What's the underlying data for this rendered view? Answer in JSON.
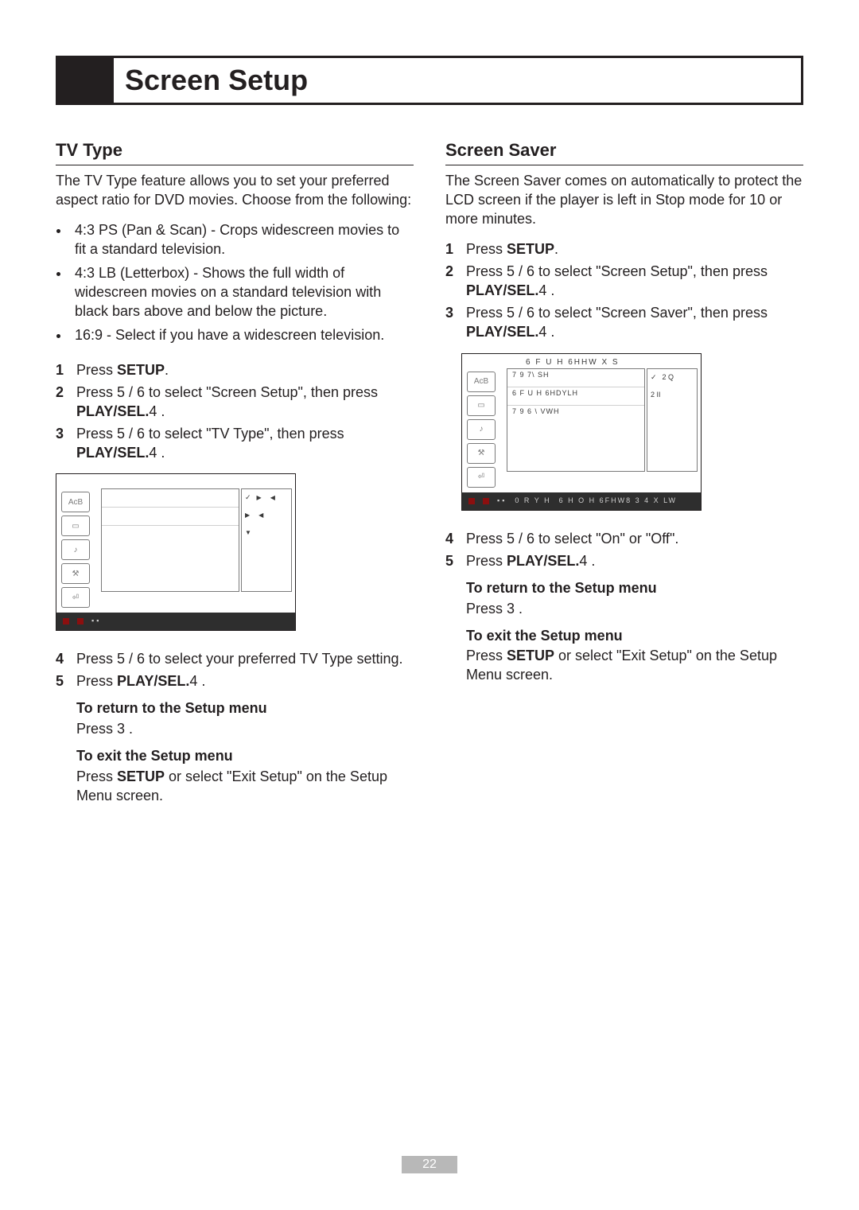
{
  "title": "Screen Setup",
  "page_number": "22",
  "col_left": {
    "section_title": "TV Type",
    "intro": "The TV Type feature allows you to set your preferred aspect ratio for DVD movies. Choose from the following:",
    "bullets": [
      "4:3 PS (Pan & Scan) - Crops widescreen movies to fit a standard television.",
      "4:3 LB (Letterbox) - Shows the full width of widescreen movies on a standard television with black bars above and below the picture.",
      "16:9 - Select if you have a widescreen television."
    ],
    "steps_1": [
      {
        "pre": "Press ",
        "strong": "SETUP",
        "post": "."
      },
      {
        "pre": "Press  5  / 6    to select \"Screen Setup\", then press ",
        "strong": "PLAY/SEL.",
        "post": "4  ."
      },
      {
        "pre": "Press  5  / 6  to select \"TV Type\", then press ",
        "strong": "PLAY/SEL.",
        "post": "4  ."
      }
    ],
    "osd": {
      "header": "",
      "panel_rows": [
        "",
        "",
        ""
      ],
      "values": [
        "",
        "",
        ""
      ],
      "footer_left": "",
      "footer_mid": "",
      "footer_right": ""
    },
    "steps_2": [
      {
        "pre": "Press  5  / 6    to select your preferred TV Type setting.",
        "strong": "",
        "post": ""
      },
      {
        "pre": "Press ",
        "strong": "PLAY/SEL.",
        "post": "4  ."
      }
    ],
    "sub_return_title": "To return to the Setup menu",
    "sub_return_body": "Press  3  .",
    "sub_exit_title": "To exit the Setup menu",
    "sub_exit_pre": "Press ",
    "sub_exit_strong": "SETUP",
    "sub_exit_post": " or select \"Exit Setup\" on the Setup Menu screen."
  },
  "col_right": {
    "section_title": "Screen Saver",
    "intro": "The Screen Saver comes on automatically to protect the LCD screen if the player is left in Stop mode for 10 or more minutes.",
    "steps_1": [
      {
        "pre": "Press ",
        "strong": "SETUP",
        "post": "."
      },
      {
        "pre": "Press  5  / 6   to select \"Screen Setup\", then press ",
        "strong": "PLAY/SEL.",
        "post": "4  ."
      },
      {
        "pre": "Press  5  / 6  to select \"Screen Saver\", then press ",
        "strong": "PLAY/SEL.",
        "post": "4  ."
      }
    ],
    "osd": {
      "header": "6 F U H 6HHW X S",
      "panel_rows": [
        "7 9 7\\ SH",
        "6 F U H 6HDYLH",
        "7 9  6 \\ VWH"
      ],
      "values": [
        "2 Q",
        "2 II"
      ],
      "footer_left": "0 R Y H",
      "footer_right": "6 H O H 6FHW8 3 4 X LW"
    },
    "steps_2": [
      {
        "pre": "Press  5  / 6   to select \"On\" or \"Off\".",
        "strong": "",
        "post": ""
      },
      {
        "pre": "Press ",
        "strong": "PLAY/SEL.",
        "post": "4  ."
      }
    ],
    "sub_return_title": "To return to the Setup menu",
    "sub_return_body": "Press  3  .",
    "sub_exit_title": "To exit the Setup menu",
    "sub_exit_pre": "Press ",
    "sub_exit_strong": "SETUP",
    "sub_exit_post": " or select \"Exit Setup\" on the Setup Menu screen."
  }
}
